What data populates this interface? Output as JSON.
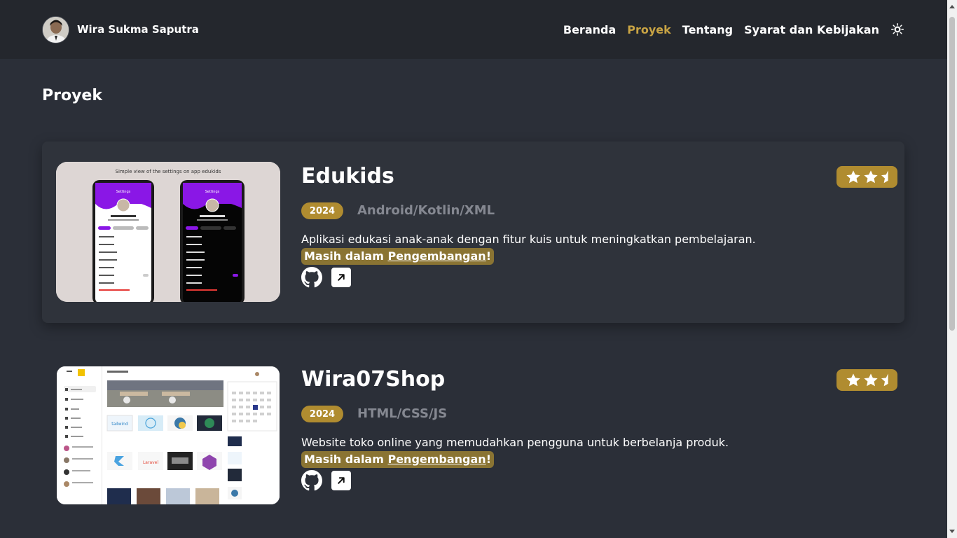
{
  "header": {
    "name": "Wira Sukma Saputra",
    "nav": [
      {
        "label": "Beranda",
        "active": false
      },
      {
        "label": "Proyek",
        "active": true
      },
      {
        "label": "Tentang",
        "active": false
      },
      {
        "label": "Syarat dan Kebijakan",
        "active": false
      }
    ],
    "theme_icon": "sun-gear-icon"
  },
  "page": {
    "title": "Proyek"
  },
  "projects": [
    {
      "title": "Edukids",
      "year": "2024",
      "tech": "Android/Kotlin/XML",
      "description": "Aplikasi edukasi anak-anak dengan fitur kuis untuk meningkatkan pembelajaran.",
      "status_prefix": "Masih dalam ",
      "status_link": "Pengembangan",
      "status_suffix": "!",
      "rating_stars": 2.5,
      "thumbnail_caption": "Simple view of the settings on app edukids",
      "phone_title": "Settings"
    },
    {
      "title": "Wira07Shop",
      "year": "2024",
      "tech": "HTML/CSS/JS",
      "description": "Website toko online yang memudahkan pengguna untuk berbelanja produk.",
      "status_prefix": "Masih dalam ",
      "status_link": "Pengembangan",
      "status_suffix": "!",
      "rating_stars": 2.5
    }
  ],
  "colors": {
    "accent": "#c9a444",
    "badge": "#b08c30",
    "background": "#2b2f38",
    "header": "#24272d"
  }
}
